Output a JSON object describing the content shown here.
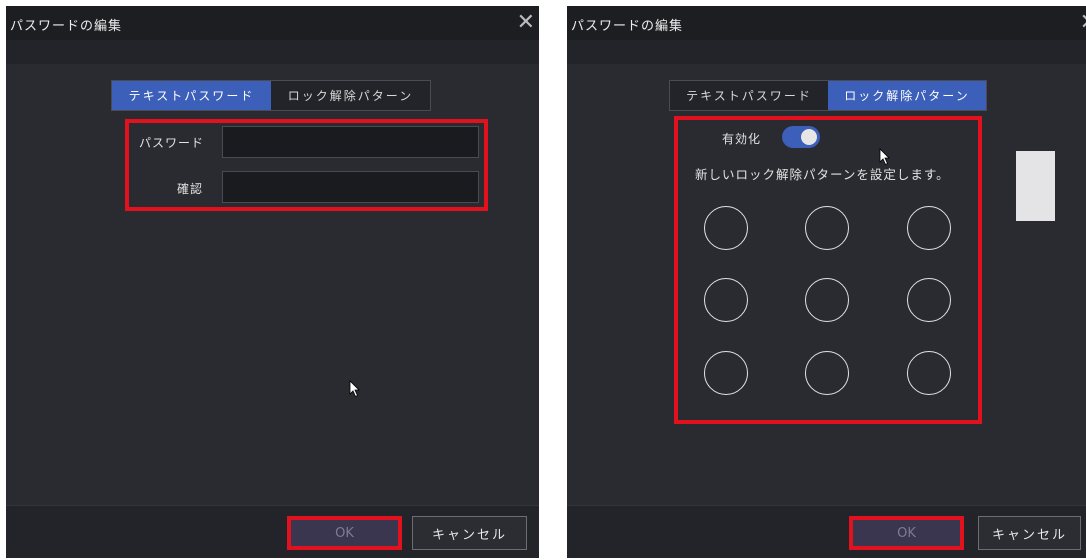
{
  "dialog_left": {
    "title": "パスワードの編集",
    "close_glyph": "✕",
    "tabs": [
      {
        "label": "テキストパスワード",
        "active": true
      },
      {
        "label": "ロック解除パターン",
        "active": false
      }
    ],
    "fields": {
      "password_label": "パスワード",
      "password_value": "",
      "confirm_label": "確認",
      "confirm_value": ""
    },
    "ok_label": "OK",
    "cancel_label": "キャンセル"
  },
  "dialog_right": {
    "title": "パスワードの編集",
    "close_glyph": "✕",
    "tabs": [
      {
        "label": "テキストパスワード",
        "active": false
      },
      {
        "label": "ロック解除パターン",
        "active": true
      }
    ],
    "enable_label": "有効化",
    "enable_on": true,
    "instruction": "新しいロック解除パターンを設定します。",
    "ok_label": "OK",
    "cancel_label": "キャンセル"
  },
  "colors": {
    "accent": "#3c5fb9",
    "highlight": "#e1121e",
    "panel": "#2a2b31",
    "dialog": "#232429"
  },
  "icons": [
    "close-icon",
    "mouse-cursor-icon"
  ]
}
